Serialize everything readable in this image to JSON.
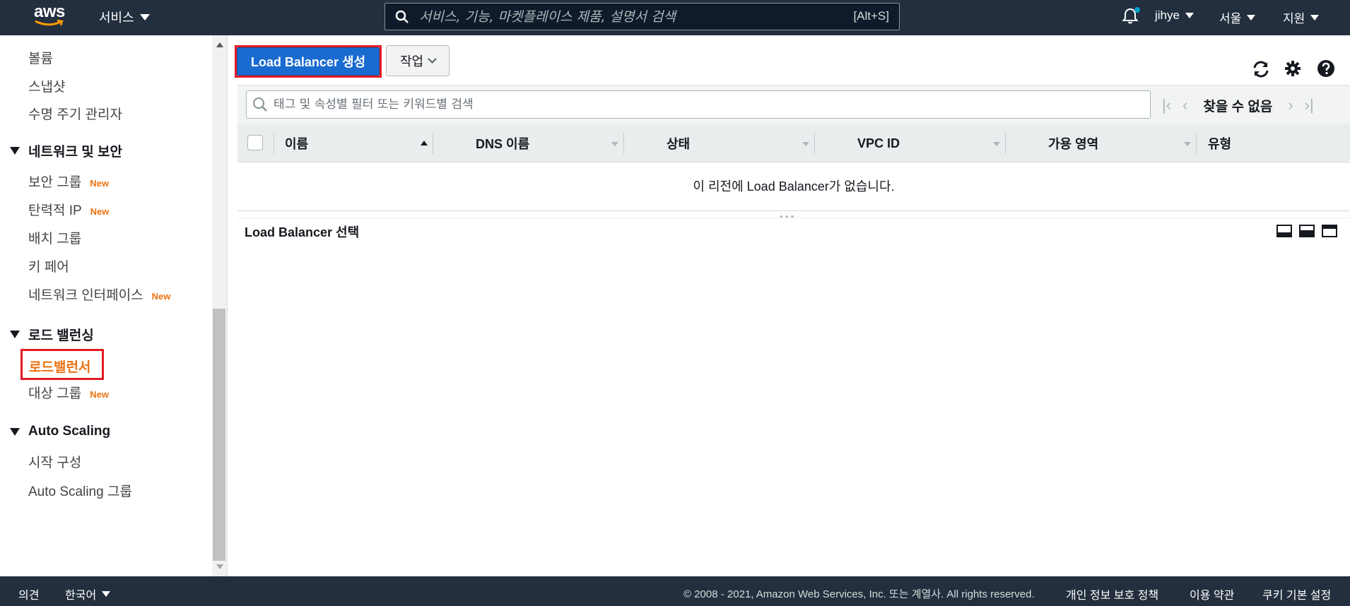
{
  "topnav": {
    "logo_text": "aws",
    "services_label": "서비스",
    "search_placeholder": "서비스, 기능, 마켓플레이스 제품, 설명서 검색",
    "search_shortcut": "[Alt+S]",
    "user_label": "jihye",
    "region_label": "서울",
    "support_label": "지원"
  },
  "sidebar": {
    "items_top": [
      "볼륨",
      "스냅샷",
      "수명 주기 관리자"
    ],
    "section_network": "네트워크 및 보안",
    "network_items": [
      {
        "label": "보안 그룹",
        "badge": "New"
      },
      {
        "label": "탄력적 IP",
        "badge": "New"
      },
      {
        "label": "배치 그룹",
        "badge": ""
      },
      {
        "label": "키 페어",
        "badge": ""
      },
      {
        "label": "네트워크 인터페이스",
        "badge": "New"
      }
    ],
    "section_lb": "로드 밸런싱",
    "lb_active": "로드밸런서",
    "lb_target": {
      "label": "대상 그룹",
      "badge": "New"
    },
    "section_as": "Auto Scaling",
    "as_items": [
      "시작 구성",
      "Auto Scaling 그룹"
    ]
  },
  "toolbar": {
    "create_label": "Load Balancer 생성",
    "action_label": "작업"
  },
  "filter": {
    "placeholder": "태그 및 속성별 필터 또는 키워드별 검색",
    "pager_status": "찾을 수 없음"
  },
  "table": {
    "columns": [
      "이름",
      "DNS 이름",
      "상태",
      "VPC ID",
      "가용 영역",
      "유형"
    ],
    "empty_message": "이 리전에 Load Balancer가 없습니다."
  },
  "detail": {
    "title": "Load Balancer 선택"
  },
  "footer": {
    "feedback": "의견",
    "language": "한국어",
    "copyright": "© 2008 - 2021, Amazon Web Services, Inc. 또는 계열사. All rights reserved.",
    "privacy": "개인 정보 보호 정책",
    "terms": "이용 약관",
    "cookies": "쿠키 기본 설정"
  },
  "colors": {
    "nav_bg": "#232f3e",
    "accent_orange": "#ec7211",
    "primary_blue": "#1a6bd0",
    "highlight_red": "#e31b23"
  }
}
